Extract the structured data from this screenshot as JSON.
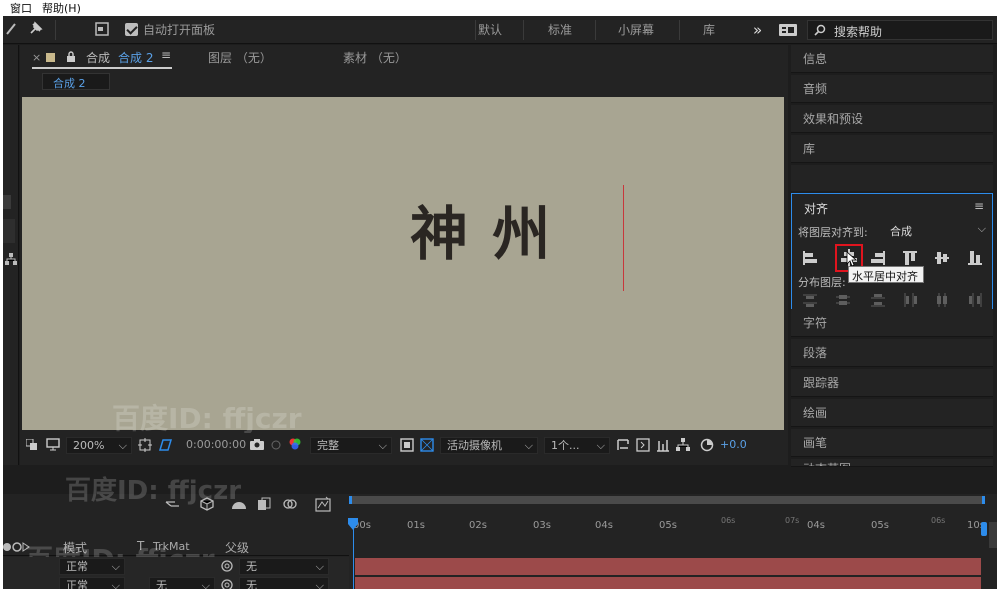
{
  "menu": {
    "window": "窗口",
    "help": "帮助(H)"
  },
  "toolbar": {
    "auto_open_panel": "自动打开面板",
    "workspaces": [
      "默认",
      "标准",
      "小屏幕",
      "库"
    ],
    "more": "»",
    "search_placeholder": "搜索帮助"
  },
  "comp_panel": {
    "tab_comp_prefix": "合成",
    "tab_comp_name": "合成 2",
    "tab_layer": "图层 （无）",
    "tab_footage": "素材 （无）",
    "breadcrumb": "合成 2",
    "canvas_text": "神 州",
    "footer": {
      "zoom": "200%",
      "timecode": "0:00:00:00",
      "quality": "完整",
      "camera": "活动摄像机",
      "views": "1个...",
      "exposure": "+0.0"
    }
  },
  "right_panels": {
    "info": "信息",
    "audio": "音频",
    "effects": "效果和预设",
    "library": "库",
    "align": {
      "title": "对齐",
      "align_to_label": "将图层对齐到:",
      "align_to_value": "合成",
      "distribute_label": "分布图层:",
      "tooltip": "水平居中对齐"
    },
    "character": "字符",
    "paragraph": "段落",
    "tracker": "跟踪器",
    "paint": "绘画",
    "brush": "画笔",
    "motion": "动态草图"
  },
  "timeline": {
    "col_mode": "模式",
    "col_t": "T",
    "col_trkmat": "TrkMat",
    "col_parent": "父级",
    "rows": [
      {
        "mode": "正常",
        "trkmat": "",
        "parent": "无"
      },
      {
        "mode": "正常",
        "trkmat": "无",
        "parent": "无"
      }
    ],
    "ticks": [
      "00s",
      "01s",
      "02s",
      "03s",
      "04s",
      "05s",
      "06s",
      "07s",
      "04s",
      "05s",
      "06s",
      "10s"
    ]
  },
  "watermark": {
    "line1": "百度ID: ffjczr",
    "line2": "百度ID: ffjczr",
    "line3": "百度ID: ffjczr"
  },
  "colors": {
    "accent": "#2d8ceb",
    "canvas": "#a8a592",
    "layer_bar": "#9c4a4a",
    "highlight": "#e0141e"
  }
}
